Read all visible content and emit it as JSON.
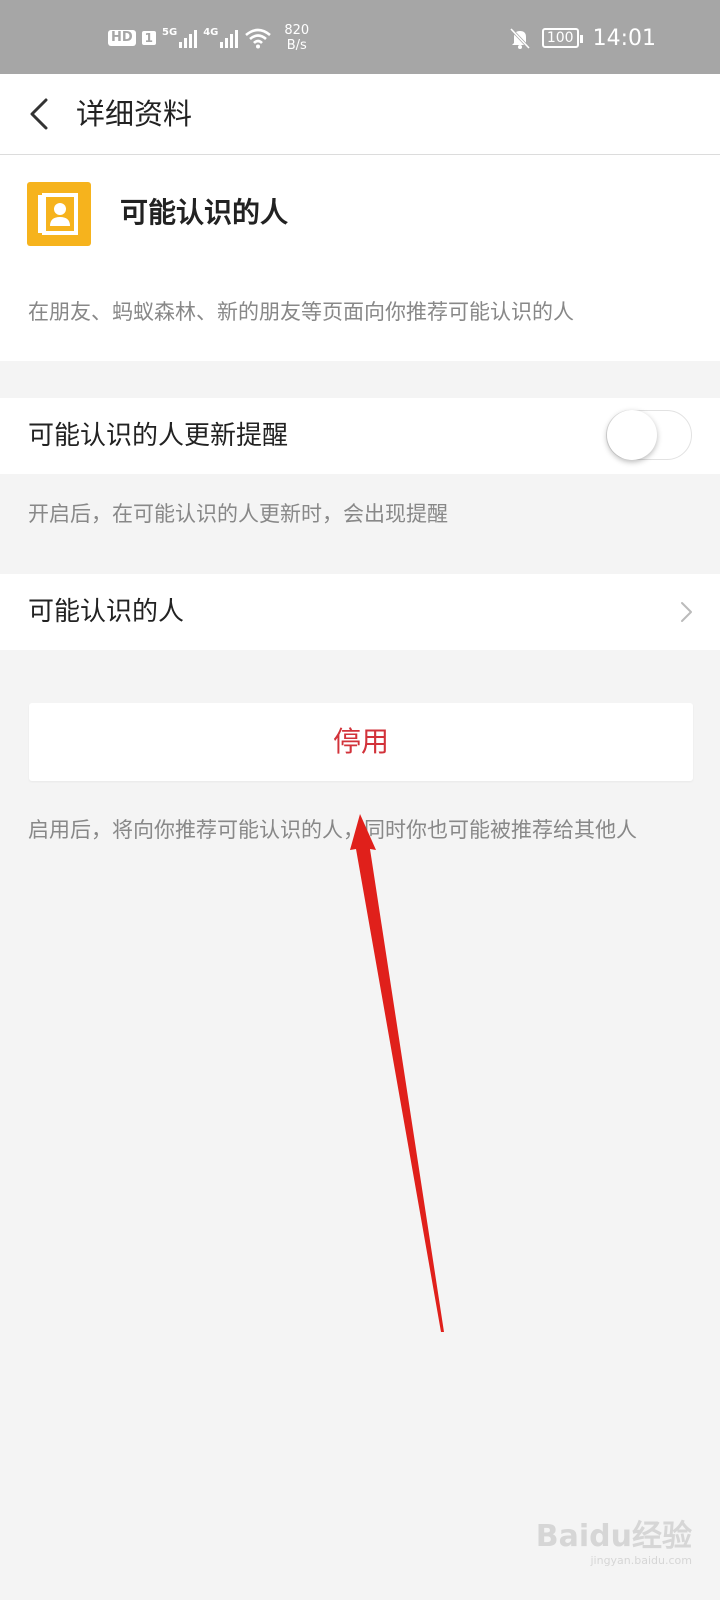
{
  "status_bar": {
    "hd": "HD",
    "sim": "1",
    "net1": "5G",
    "net2": "4G",
    "speed_value": "820",
    "speed_unit": "B/s",
    "battery": "100",
    "time": "14:01",
    "icons": [
      "signal-icon",
      "wifi-icon",
      "mute-bell-icon",
      "battery-icon"
    ]
  },
  "header": {
    "title": "详细资料",
    "back_icon": "back-arrow-icon"
  },
  "app": {
    "icon": "contact-card-icon",
    "icon_color": "#f6b31d",
    "name": "可能认识的人",
    "description": "在朋友、蚂蚁森林、新的朋友等页面向你推荐可能认识的人"
  },
  "settings": {
    "update_reminder_label": "可能认识的人更新提醒",
    "update_reminder_on": false,
    "update_reminder_hint": "开启后，在可能认识的人更新时，会出现提醒",
    "people_link_label": "可能认识的人"
  },
  "actions": {
    "disable_label": "停用",
    "disable_color": "#d2323a",
    "disable_hint": "启用后，将向你推荐可能认识的人，同时你也可能被推荐给其他人"
  },
  "watermark": {
    "main": "Baidu经验",
    "sub": "jingyan.baidu.com"
  }
}
